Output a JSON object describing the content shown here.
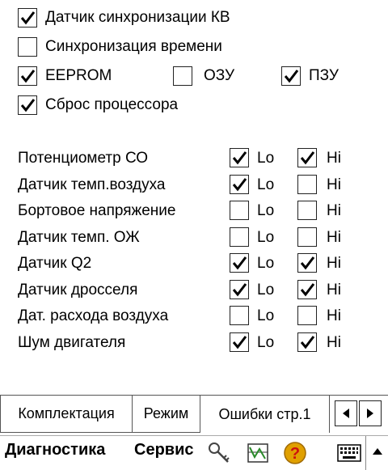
{
  "options": [
    {
      "label": "Датчик синхронизации КВ",
      "checked": true
    },
    {
      "label": "Синхронизация времени",
      "checked": false
    }
  ],
  "memory": [
    {
      "label": "EEPROM",
      "checked": true
    },
    {
      "label": "ОЗУ",
      "checked": false
    },
    {
      "label": "ПЗУ",
      "checked": true
    }
  ],
  "reset": {
    "label": "Сброс процессора",
    "checked": true
  },
  "lo_label": "Lo",
  "hi_label": "Hi",
  "sensors": [
    {
      "label": "Потенциометр СО",
      "lo": true,
      "hi": true
    },
    {
      "label": "Датчик темп.воздуха",
      "lo": true,
      "hi": false
    },
    {
      "label": "Бортовое напряжение",
      "lo": false,
      "hi": false
    },
    {
      "label": "Датчик темп. ОЖ",
      "lo": false,
      "hi": false
    },
    {
      "label": "Датчик Q2",
      "lo": true,
      "hi": true
    },
    {
      "label": "Датчик дросселя",
      "lo": true,
      "hi": true
    },
    {
      "label": "Дат. расхода воздуха",
      "lo": false,
      "hi": false
    },
    {
      "label": "Шум двигателя",
      "lo": true,
      "hi": true
    }
  ],
  "tabs": [
    {
      "label": "Комплектация",
      "active": false
    },
    {
      "label": "Режим",
      "active": false
    },
    {
      "label": "Ошибки стр.1",
      "active": true
    }
  ],
  "menu": {
    "diagnostics": "Диагностика",
    "service": "Сервис"
  },
  "icons": [
    "keys-icon",
    "chart-icon",
    "help-icon",
    "keyboard-icon",
    "up-arrow-icon"
  ],
  "colors": {
    "help_icon": "#e0a000",
    "chart_icon": "#2a8a2a"
  }
}
